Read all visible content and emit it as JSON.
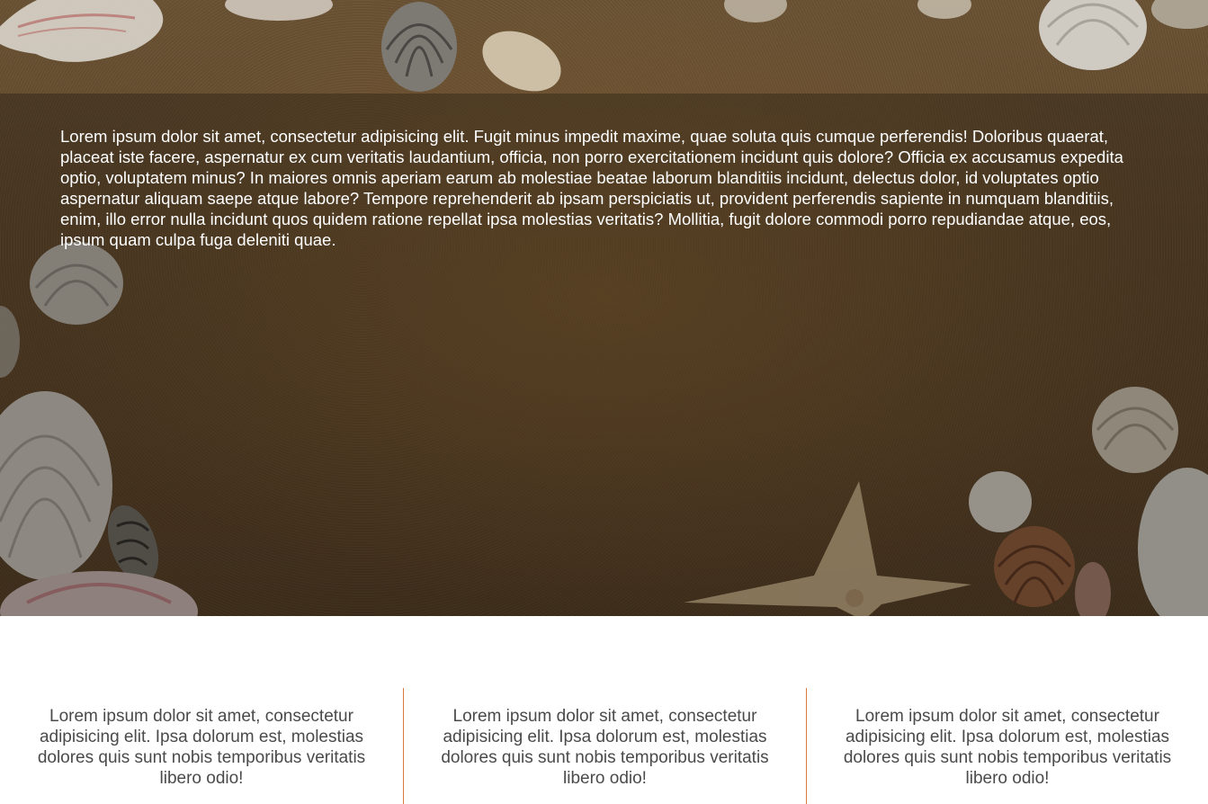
{
  "hero": {
    "paragraph": "Lorem ipsum dolor sit amet, consectetur adipisicing elit. Fugit minus impedit maxime, quae soluta quis cumque perferendis! Doloribus quaerat, placeat iste facere, aspernatur ex cum veritatis laudantium, officia, non porro exercitationem incidunt quis dolore? Officia ex accusamus expedita optio, voluptatem minus? In maiores omnis aperiam earum ab molestiae beatae laborum blanditiis incidunt, delectus dolor, id voluptates optio aspernatur aliquam saepe atque labore? Tempore reprehenderit ab ipsam perspiciatis ut, provident perferendis sapiente in numquam blanditiis, enim, illo error nulla incidunt quos quidem ratione repellat ipsa molestias veritatis? Mollitia, fugit dolore commodi porro repudiandae atque, eos, ipsum quam culpa fuga deleniti quae.",
    "background": "sand-with-seashells-image"
  },
  "columns": [
    {
      "text": "Lorem ipsum dolor sit amet, consectetur adipisicing elit. Ipsa dolorum est, molestias dolores quis sunt nobis temporibus veritatis libero odio!"
    },
    {
      "text": "Lorem ipsum dolor sit amet, consectetur adipisicing elit. Ipsa dolorum est, molestias dolores quis sunt nobis temporibus veritatis libero odio!"
    },
    {
      "text": "Lorem ipsum dolor sit amet, consectetur adipisicing elit. Ipsa dolorum est, molestias dolores quis sunt nobis temporibus veritatis libero odio!"
    }
  ],
  "colors": {
    "divider": "#d97a3a",
    "column_text": "#4a4a4a",
    "hero_text": "#ffffff"
  }
}
